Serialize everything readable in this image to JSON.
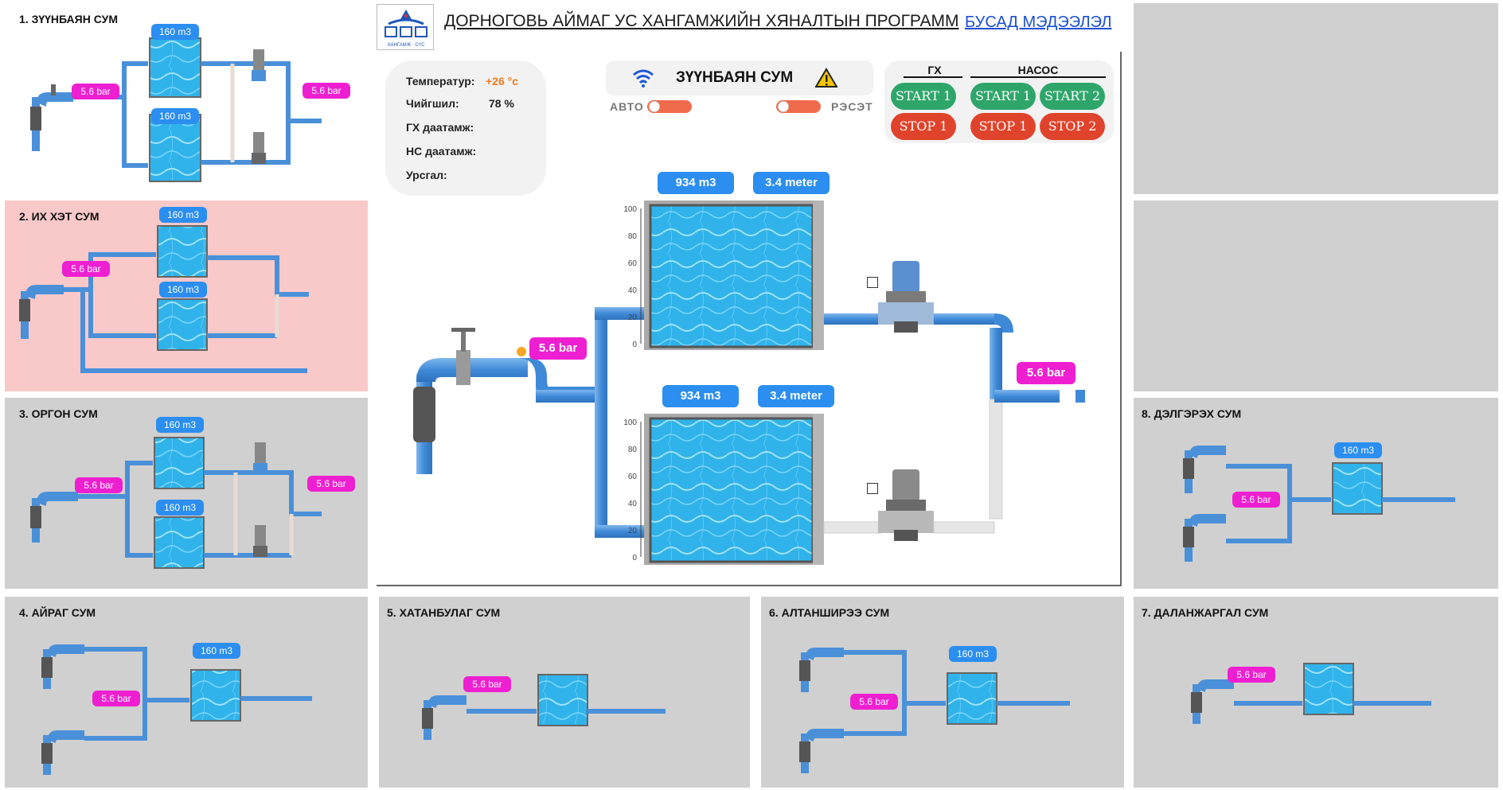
{
  "header": {
    "title": "ДОРНОГОВЬ АЙМАГ УС ХАНГАМЖИЙН ХЯНАЛТЫН ПРОГРАММ",
    "more_link": "БУСАД МЭДЭЭЛЭЛ",
    "logo_text": "ХАНГАМЖ · СҮС"
  },
  "sensors": {
    "temp_label": "Температур:",
    "temp_value": "+26 °c",
    "humidity_label": "Чийгшил:",
    "humidity_value": "78 %",
    "gh_pressure_label": "ГХ даатамж:",
    "ns_pressure_label": "НС даатамж:",
    "flow_label": "Урсгал:"
  },
  "station": {
    "name": "ЗҮҮНБАЯН СУМ",
    "auto_label": "АВТО",
    "reset_label": "РЭСЭТ"
  },
  "controls": {
    "gh_header": "ГХ",
    "pump_header": "НАСОС",
    "start1_gh": "START 1",
    "stop1_gh": "STOP 1",
    "start1_pump": "START 1",
    "start2_pump": "START 2",
    "stop1_pump": "STOP 1",
    "stop2_pump": "STOP 2"
  },
  "main_diagram": {
    "tank1_volume": "934 m3",
    "tank1_level": "3.4 meter",
    "tank2_volume": "934 m3",
    "tank2_level": "3.4 meter",
    "inlet_pressure": "5.6 bar",
    "outlet_pressure": "5.6 bar",
    "scale_ticks": [
      "100",
      "80",
      "60",
      "40",
      "20",
      "0"
    ],
    "colors": {
      "pipe": "#4a90d9",
      "water": "#33b6ea",
      "label_blue": "#2b8ef0",
      "label_pink": "#ee1fd1"
    }
  },
  "panels": {
    "p1": {
      "title": "1. ЗҮҮНБАЯН СУМ",
      "tank_a": "160 m3",
      "tank_b": "160 m3",
      "p_in": "5.6 bar",
      "p_out": "5.6 bar"
    },
    "p2": {
      "title": "2. ИХ ХЭТ СУМ",
      "tank_a": "160 m3",
      "tank_b": "160 m3",
      "p_in": "5.6 bar"
    },
    "p3": {
      "title": "3. ОРГОН  СУМ",
      "tank_a": "160 m3",
      "tank_b": "160 m3",
      "p_in": "5.6 bar",
      "p_out": "5.6 bar"
    },
    "p4": {
      "title": "4. АЙРАГ  СУМ",
      "tank": "160 m3",
      "p_in": "5.6 bar"
    },
    "p5": {
      "title": "5. ХАТАНБУЛАГ СУМ",
      "p_in": "5.6 bar"
    },
    "p6": {
      "title": "6. АЛТАНШИРЭЭ СУМ",
      "tank": "160 m3",
      "p_in": "5.6 bar"
    },
    "p7": {
      "title": "7. ДАЛАНЖАРГАЛ СУМ",
      "p_in": "5.6 bar"
    },
    "p8": {
      "title": "8. ДЭЛГЭРЭХ СУМ",
      "tank": "160 m3",
      "p_in": "5.6 bar"
    }
  }
}
